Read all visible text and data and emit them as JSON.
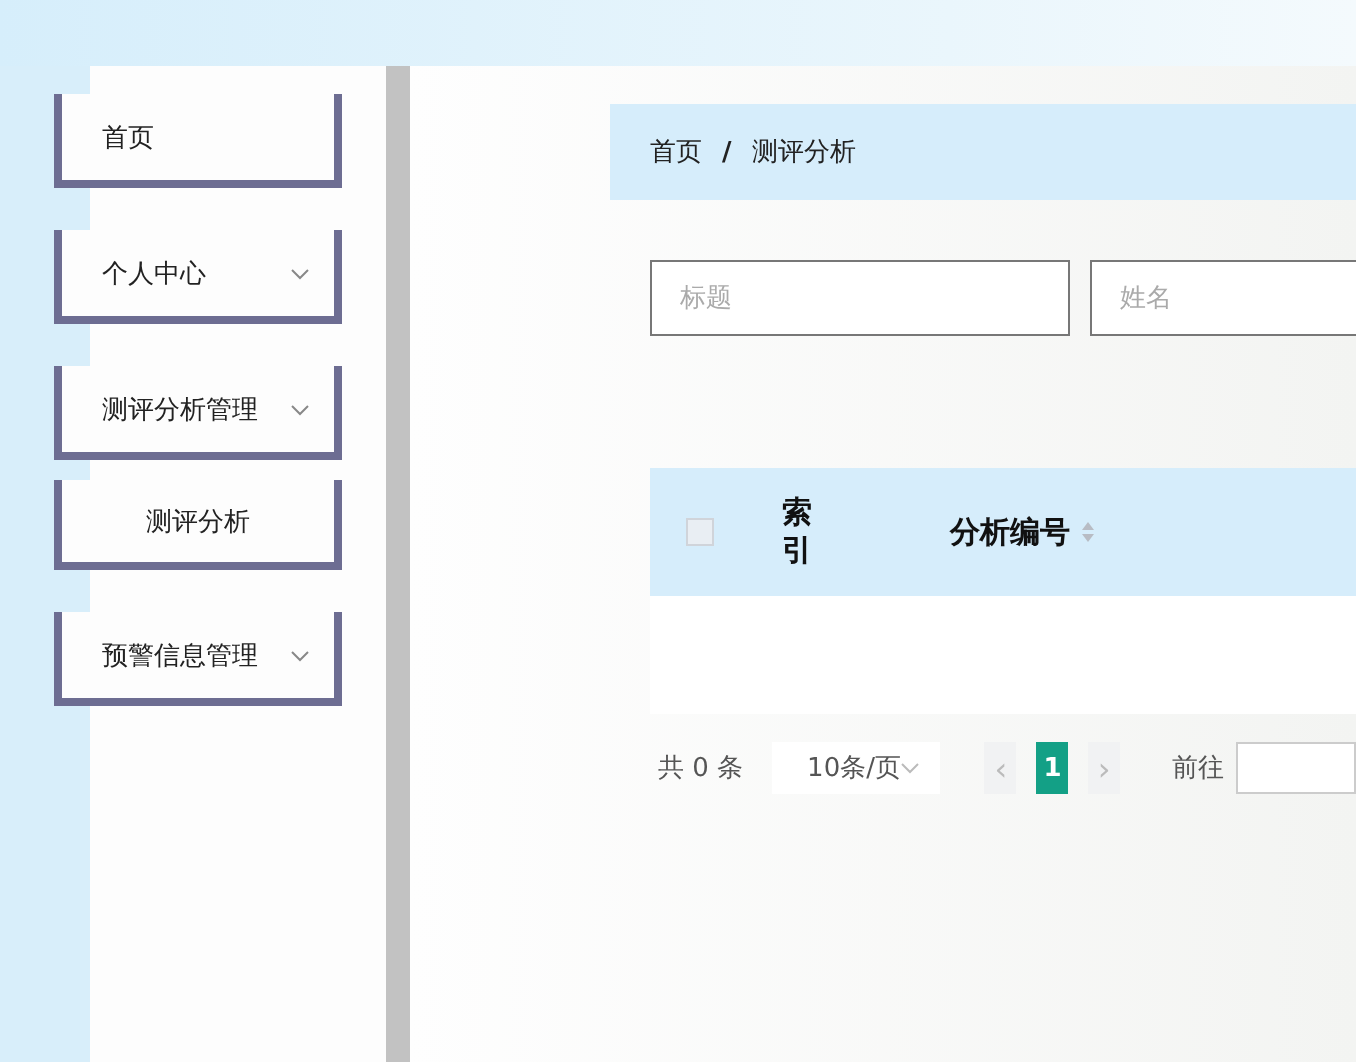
{
  "sidebar": {
    "items": [
      {
        "label": "首页",
        "kind": "link"
      },
      {
        "label": "个人中心",
        "kind": "submenu"
      },
      {
        "label": "测评分析管理",
        "kind": "submenu",
        "children": [
          {
            "label": "测评分析"
          }
        ]
      },
      {
        "label": "预警信息管理",
        "kind": "submenu"
      }
    ]
  },
  "breadcrumb": [
    "首页",
    "测评分析"
  ],
  "breadcrumb_separator": "/",
  "search": [
    {
      "placeholder": "标题"
    },
    {
      "placeholder": "姓名"
    }
  ],
  "table": {
    "columns": [
      {
        "label": "索引",
        "kind": "index"
      },
      {
        "label": "分析编号",
        "kind": "sortable"
      }
    ],
    "header_checkbox": {
      "checked": false
    }
  },
  "pagination": {
    "total": "共 0 条",
    "page_size": "10条/页",
    "prev": "‹",
    "next": "›",
    "pages": [
      {
        "label": "1",
        "selected": true
      }
    ],
    "goto": "前往"
  }
}
